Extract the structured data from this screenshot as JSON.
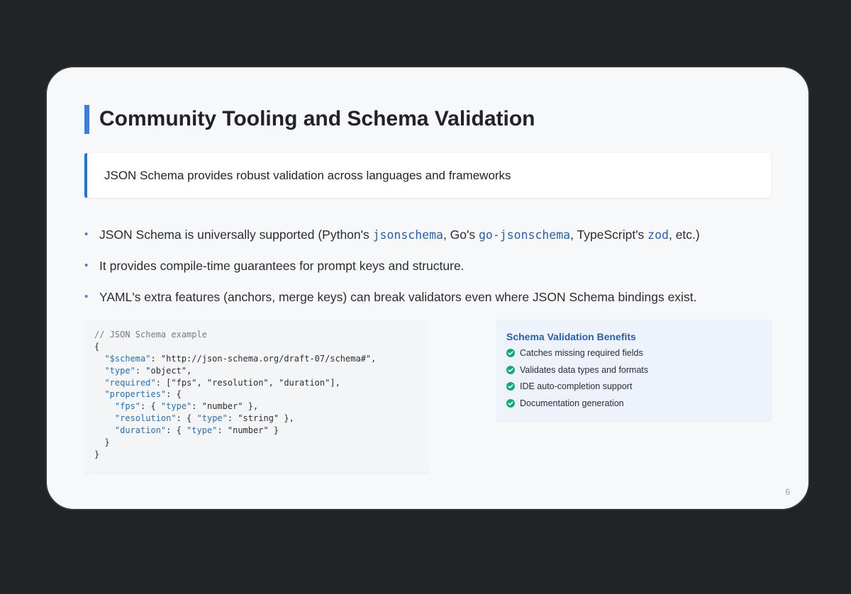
{
  "slide": {
    "title": "Community Tooling and Schema Validation",
    "callout": "JSON Schema provides robust validation across languages and frameworks",
    "bullets": [
      {
        "t1": "JSON Schema is universally supported (Python's ",
        "c1": "jsonschema",
        "t2": ", Go's ",
        "c2": "go-jsonschema",
        "t3": ", TypeScript's ",
        "c3": "zod",
        "t4": ", etc.)"
      },
      {
        "text": "It provides compile-time guarantees for prompt keys and structure."
      },
      {
        "text": "YAML's extra features (anchors, merge keys) can break validators even where JSON Schema bindings exist."
      }
    ],
    "code": {
      "comment": "// JSON Schema example",
      "open_brace": "{",
      "schema_key": "\"$schema\"",
      "schema_val": ": \"http://json-schema.org/draft-07/schema#\",",
      "type_key": "\"type\"",
      "type_val": ": \"object\",",
      "required_key": "\"required\"",
      "required_val": ": [\"fps\", \"resolution\", \"duration\"],",
      "properties_key": "\"properties\"",
      "properties_val": ": {",
      "fps_key": "\"fps\"",
      "fps_mid": ": { ",
      "fps_type_key": "\"type\"",
      "fps_type_val": ": \"number\" },",
      "res_key": "\"resolution\"",
      "res_mid": ": { ",
      "res_type_key": "\"type\"",
      "res_type_val": ": \"string\" },",
      "dur_key": "\"duration\"",
      "dur_mid": ": { ",
      "dur_type_key": "\"type\"",
      "dur_type_val": ": \"number\" }",
      "inner_close": "}",
      "close_brace": "}"
    },
    "benefits": {
      "title": "Schema Validation Benefits",
      "items": [
        "Catches missing required fields",
        "Validates data types and formats",
        "IDE auto-completion support",
        "Documentation generation"
      ]
    },
    "page_number": "6",
    "colors": {
      "accent": "#3a7fd9",
      "check": "#19a874",
      "code_key": "#2a6fa8"
    }
  }
}
